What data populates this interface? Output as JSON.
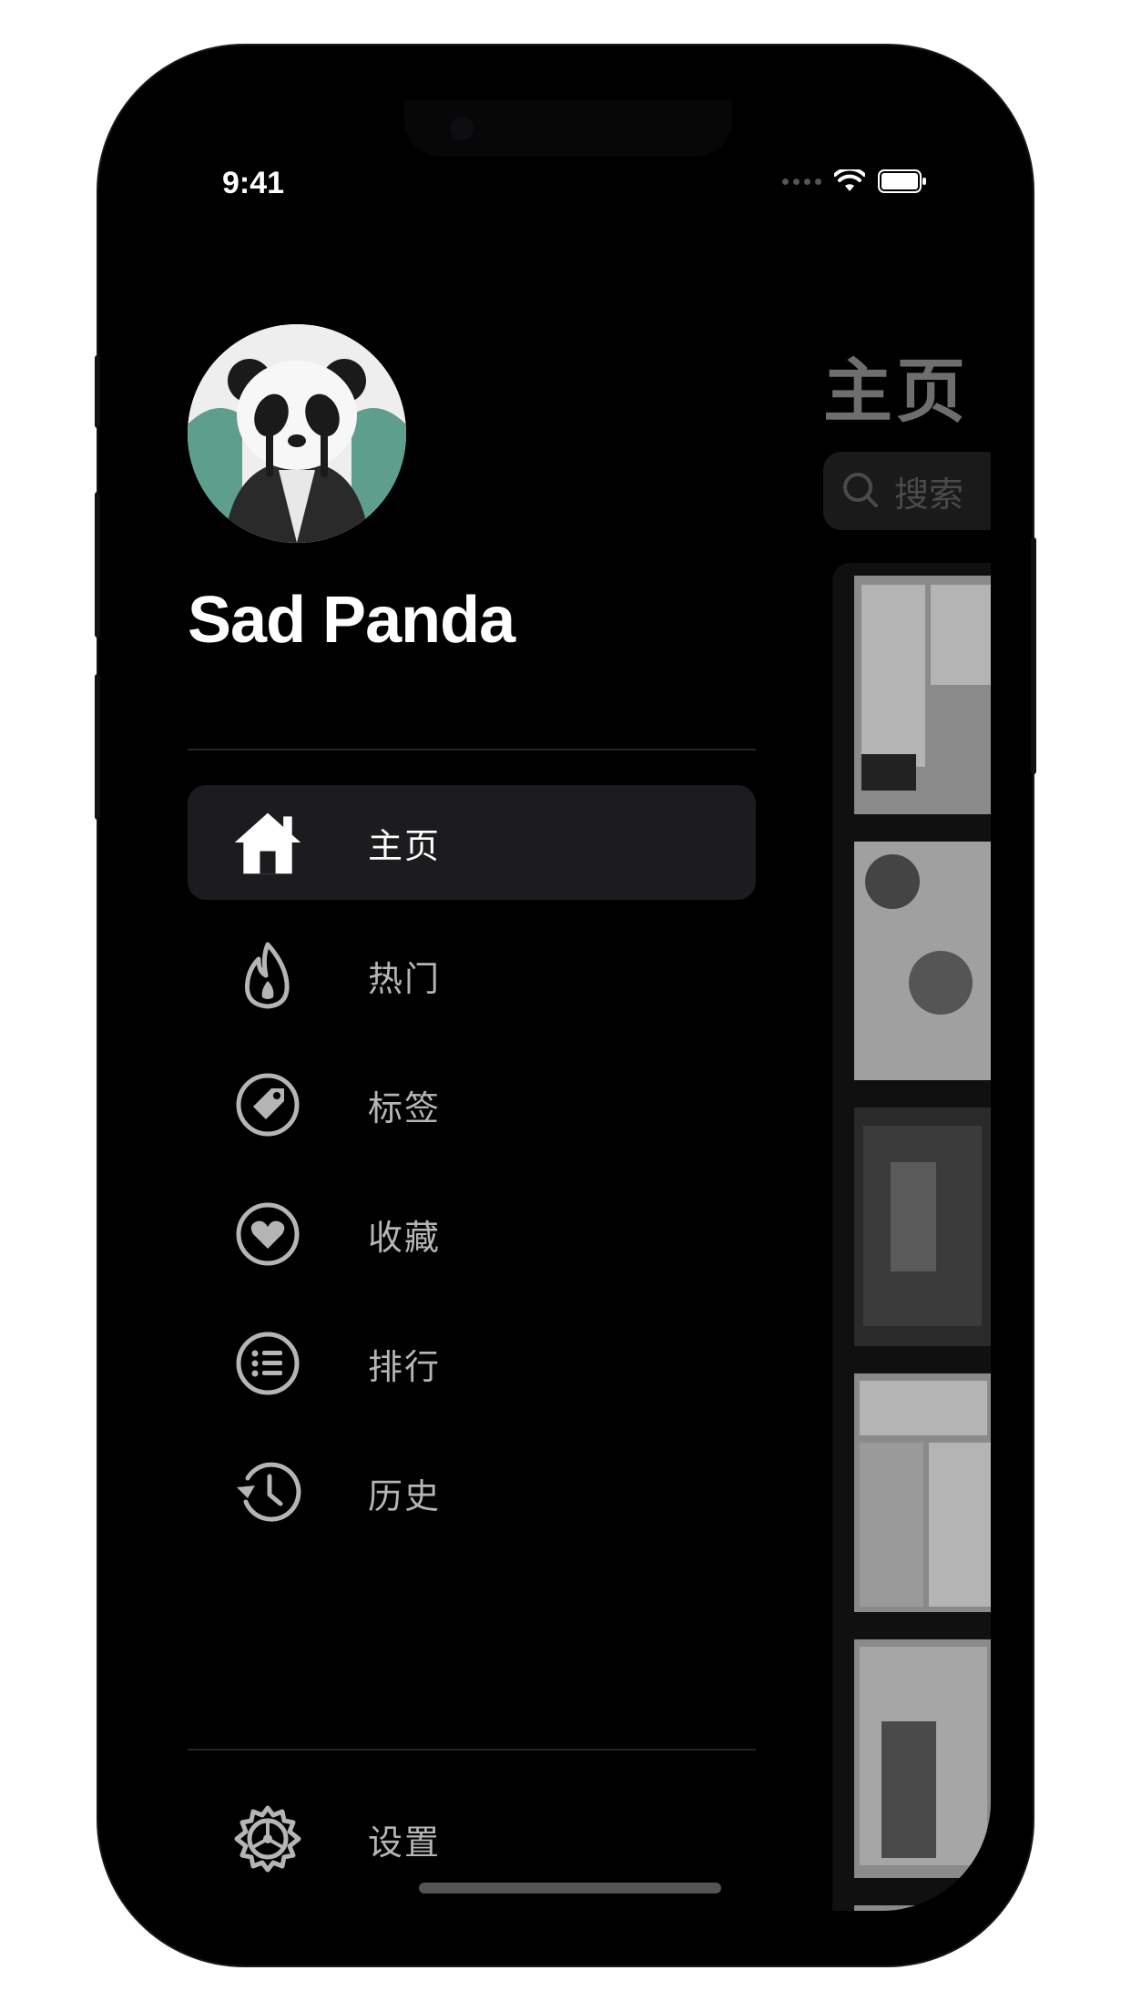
{
  "status_bar": {
    "time": "9:41"
  },
  "drawer": {
    "profile": {
      "name": "Sad Panda",
      "avatar": "crying-panda-avatar"
    },
    "menu": [
      {
        "label": "主页",
        "icon": "home-icon",
        "active": true
      },
      {
        "label": "热门",
        "icon": "flame-icon",
        "active": false
      },
      {
        "label": "标签",
        "icon": "tag-icon",
        "active": false
      },
      {
        "label": "收藏",
        "icon": "heart-icon",
        "active": false
      },
      {
        "label": "排行",
        "icon": "list-icon",
        "active": false
      },
      {
        "label": "历史",
        "icon": "history-icon",
        "active": false
      }
    ],
    "settings": {
      "label": "设置",
      "icon": "gear-icon"
    }
  },
  "main_page": {
    "title": "主页",
    "search_placeholder": "搜索"
  },
  "colors": {
    "background": "#000000",
    "active_item_bg": "#1c1c1e",
    "text_primary": "#ffffff",
    "text_secondary": "#b5b5b5"
  }
}
